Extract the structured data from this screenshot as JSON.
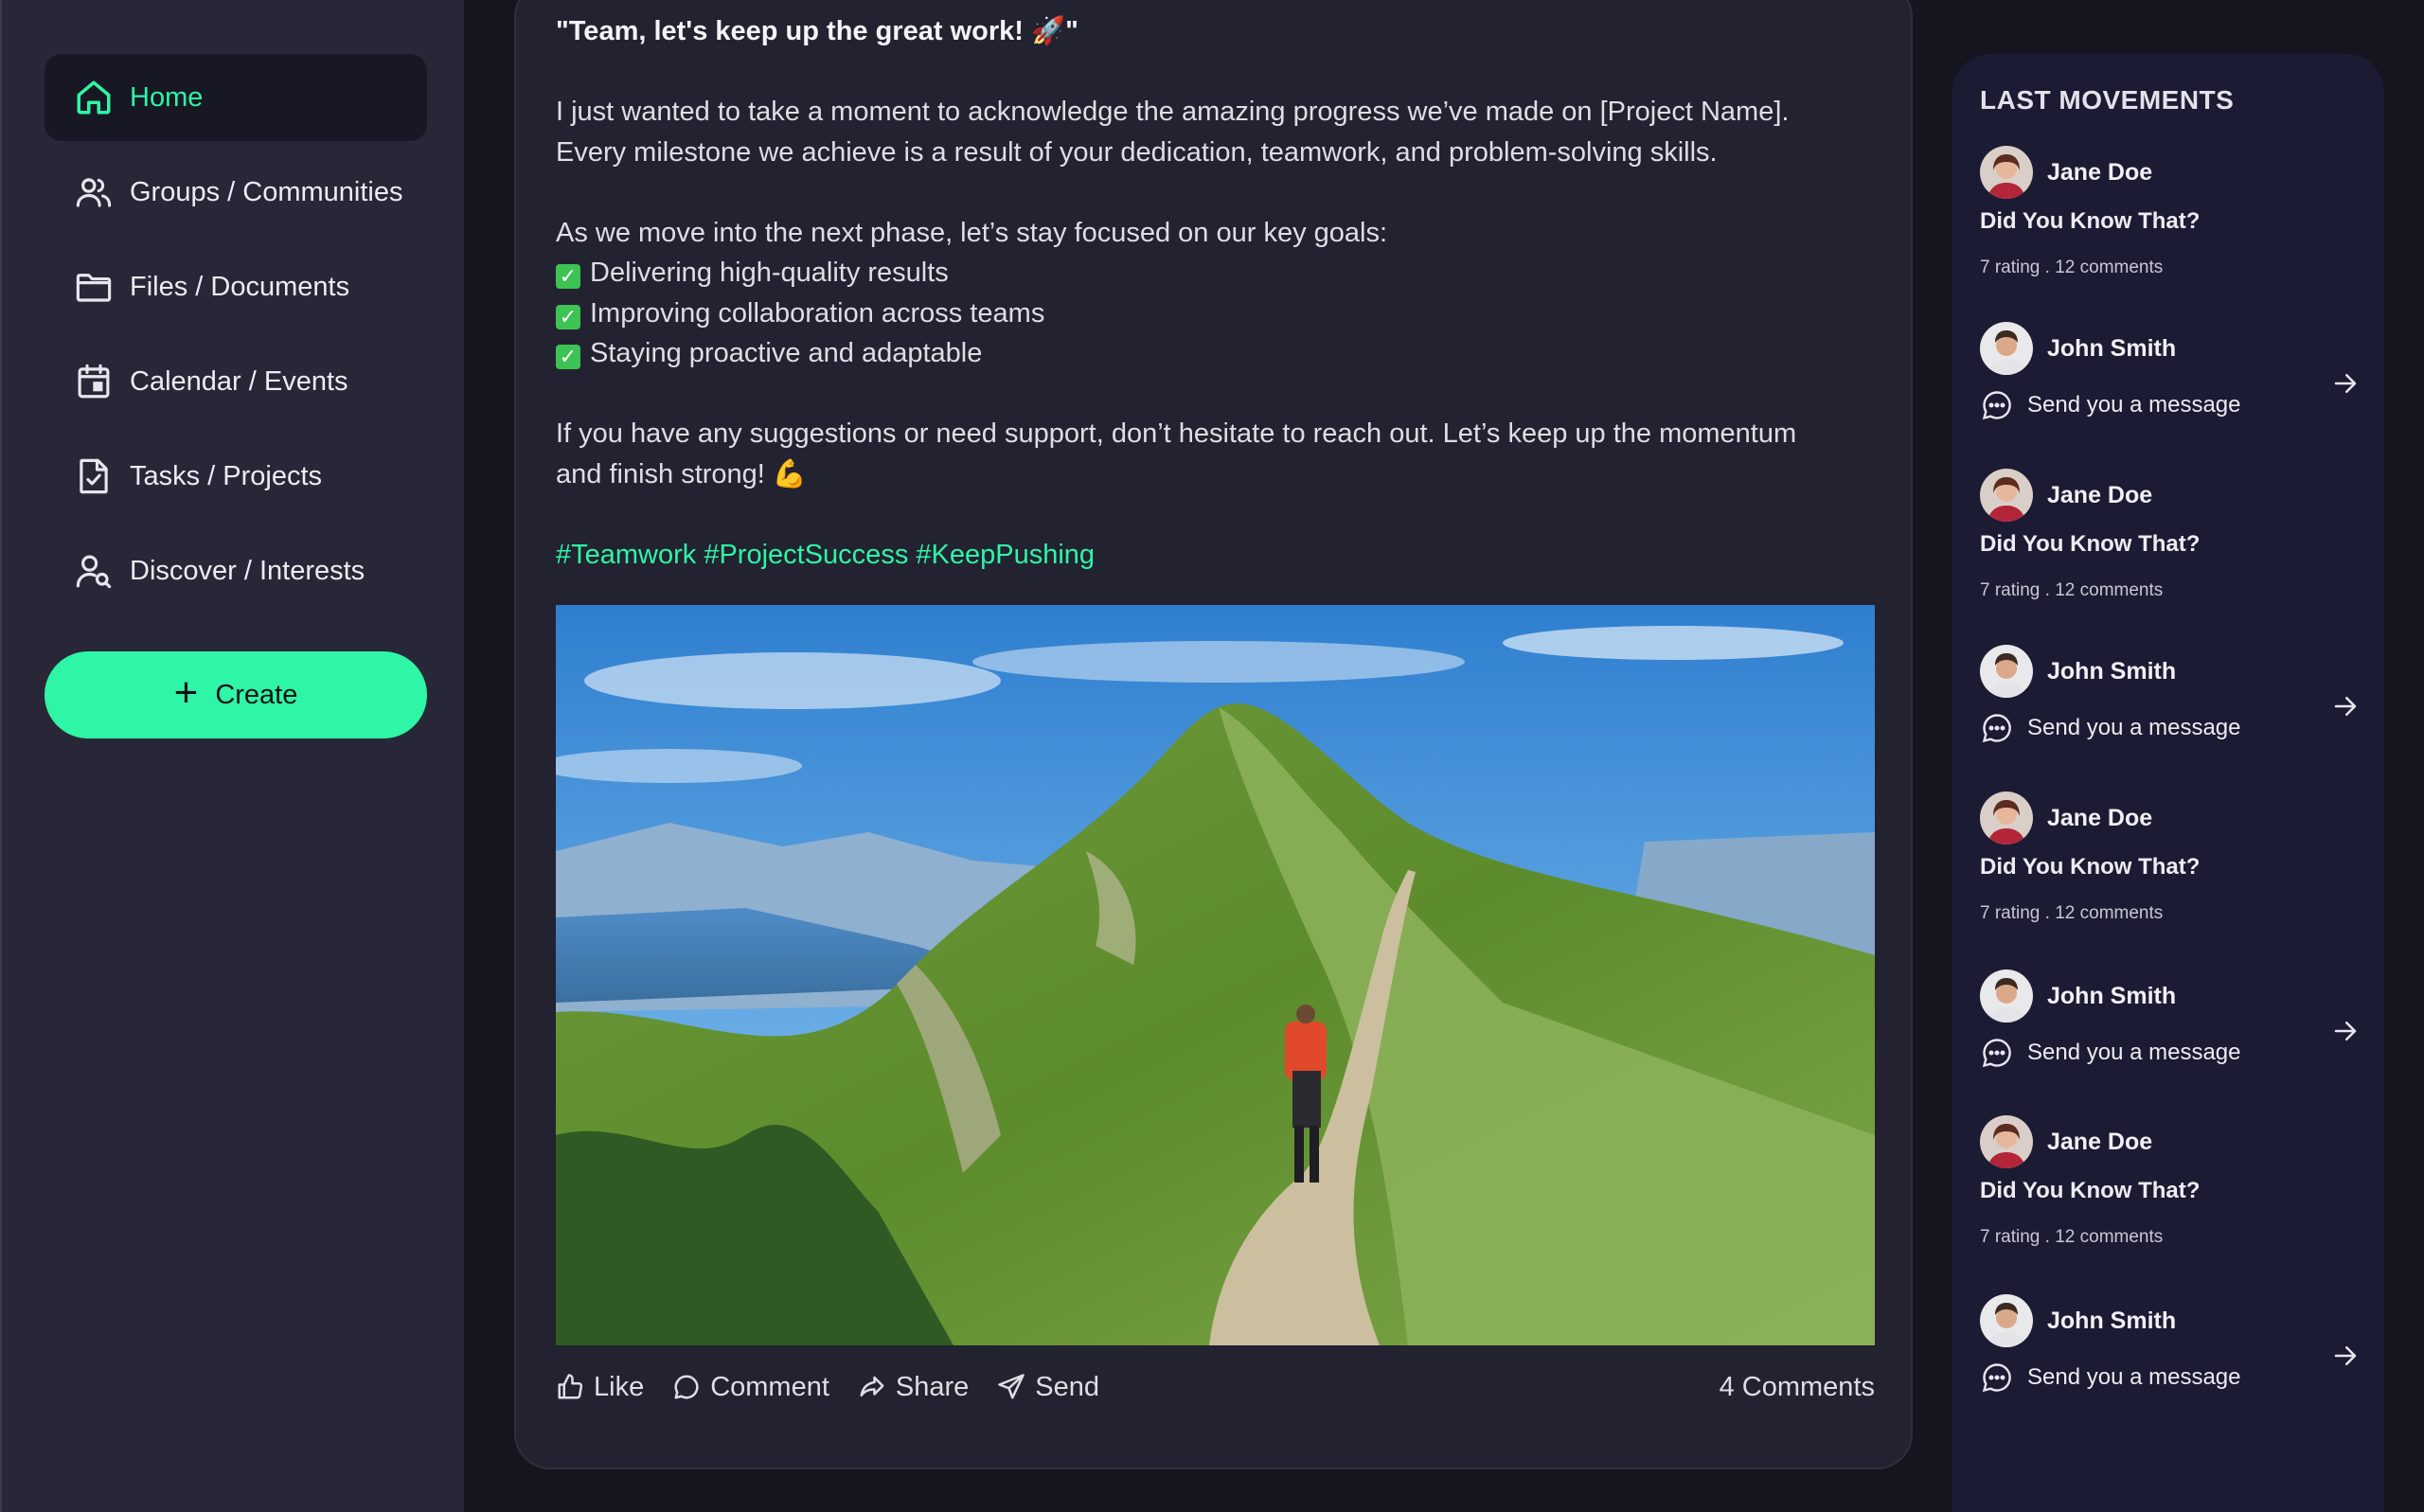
{
  "sidebar": {
    "items": [
      {
        "label": "Home",
        "icon": "home-icon"
      },
      {
        "label": "Groups / Communities",
        "icon": "users-icon"
      },
      {
        "label": "Files / Documents",
        "icon": "folder-icon"
      },
      {
        "label": "Calendar / Events",
        "icon": "calendar-icon"
      },
      {
        "label": "Tasks / Projects",
        "icon": "task-file-icon"
      },
      {
        "label": "Discover / Interests",
        "icon": "user-search-icon"
      }
    ],
    "create_label": "Create"
  },
  "post": {
    "title": "\"Team, let's keep up the great work! 🚀\"",
    "paragraph1_line1": "I just wanted to take a moment to acknowledge the amazing progress we’ve made on [Project Name].",
    "paragraph1_line2": "Every milestone we achieve is a result of your dedication, teamwork, and problem-solving skills.",
    "goals_intro": "As we move into the next phase, let’s stay focused on our key goals:",
    "goals": [
      "Delivering high-quality results",
      "Improving collaboration across teams",
      "Staying proactive and adaptable"
    ],
    "closing_line1": "If you have any suggestions or need support, don’t hesitate to reach out. Let’s keep up the momentum",
    "closing_line2": "and finish strong! 💪",
    "hashtags": "#Teamwork #ProjectSuccess #KeepPushing",
    "actions": {
      "like": "Like",
      "comment": "Comment",
      "share": "Share",
      "send": "Send"
    },
    "comments_count": "4 Comments"
  },
  "movements": {
    "title": "LAST MOVEMENTS",
    "items": [
      {
        "type": "post",
        "name": "Jane Doe",
        "subtitle": "Did You Know That?",
        "meta": "7 rating  .  12 comments"
      },
      {
        "type": "message",
        "name": "John Smith",
        "message": "Send you a message"
      },
      {
        "type": "post",
        "name": "Jane Doe",
        "subtitle": "Did You Know That?",
        "meta": "7 rating  .  12 comments"
      },
      {
        "type": "message",
        "name": "John Smith",
        "message": "Send you a message"
      },
      {
        "type": "post",
        "name": "Jane Doe",
        "subtitle": "Did You Know That?",
        "meta": "7 rating  .  12 comments"
      },
      {
        "type": "message",
        "name": "John Smith",
        "message": "Send you a message"
      },
      {
        "type": "post",
        "name": "Jane Doe",
        "subtitle": "Did You Know That?",
        "meta": "7 rating  .  12 comments"
      },
      {
        "type": "message",
        "name": "John Smith",
        "message": "Send you a message"
      }
    ]
  },
  "colors": {
    "accent": "#2ff5a6",
    "background": "#15151f",
    "sidebar": "#272737",
    "card": "#222231",
    "panel": "#1b1b33"
  }
}
